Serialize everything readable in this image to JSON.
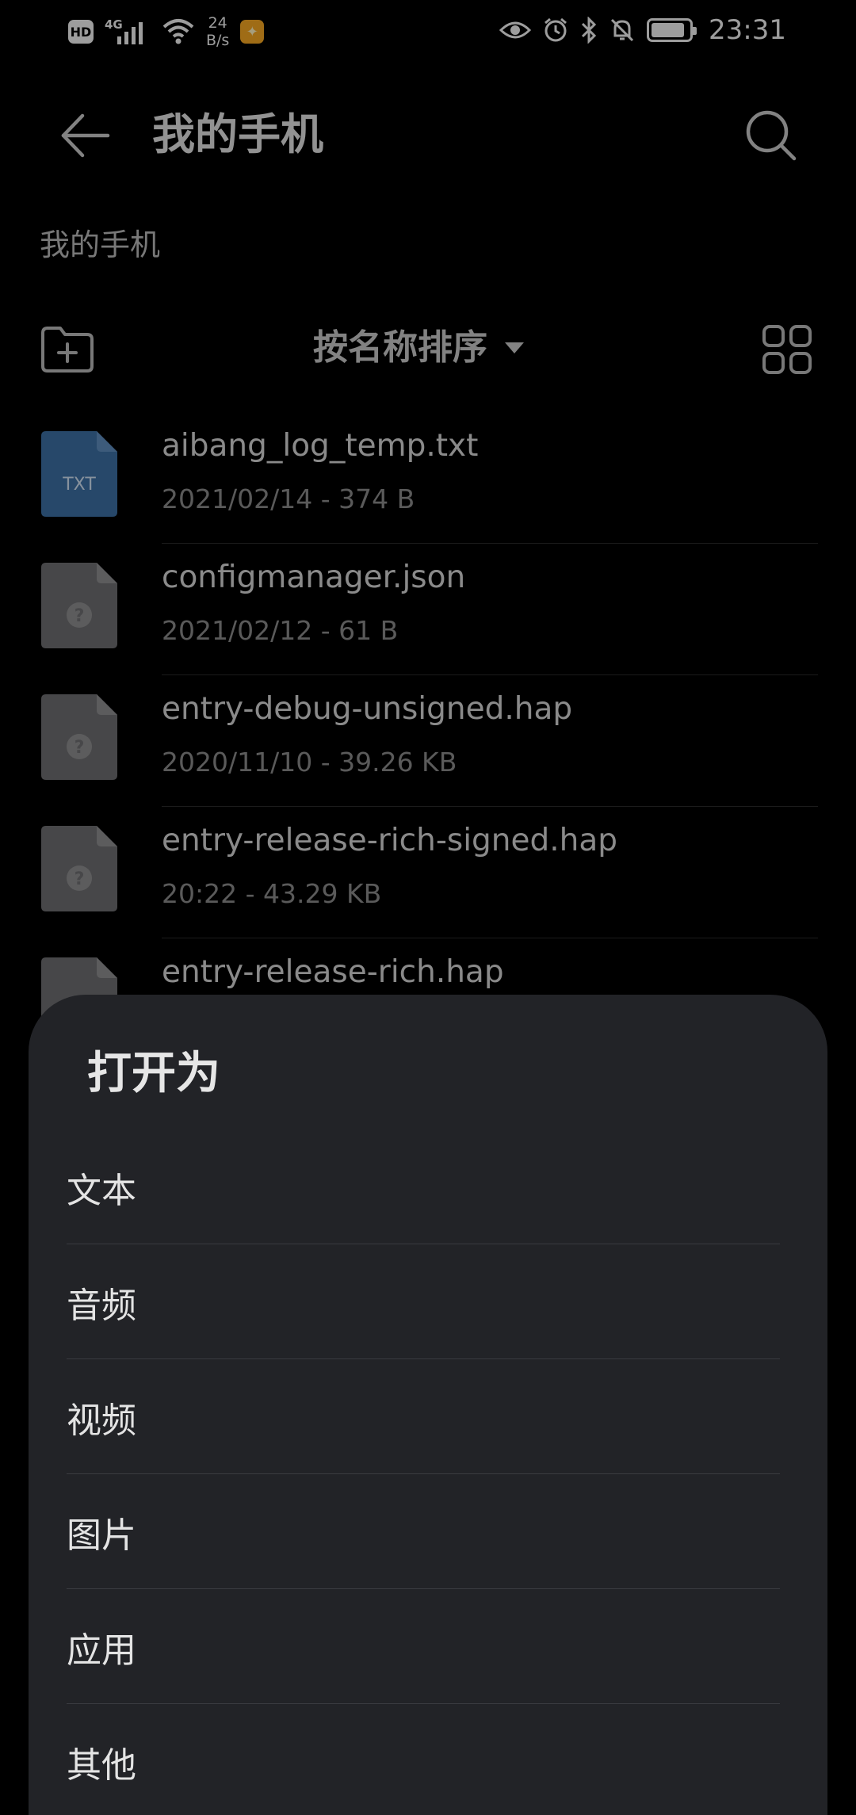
{
  "status_bar": {
    "hd": "HD",
    "network": "4G",
    "speed_value": "24",
    "speed_unit": "B/s",
    "time": "23:31",
    "battery_level": 0.9
  },
  "app_bar": {
    "title": "我的手机"
  },
  "breadcrumb": "我的手机",
  "toolbar": {
    "sort_label": "按名称排序"
  },
  "files": [
    {
      "name": "aibang_log_temp.txt",
      "meta": "2021/02/14 - 374 B",
      "icon": "txt-file-icon",
      "icon_label": "TXT"
    },
    {
      "name": "configmanager.json",
      "meta": "2021/02/12 - 61 B",
      "icon": "unknown-file-icon"
    },
    {
      "name": "entry-debug-unsigned.hap",
      "meta": "2020/11/10 - 39.26 KB",
      "icon": "unknown-file-icon"
    },
    {
      "name": "entry-release-rich-signed.hap",
      "meta": "20:22 - 43.29 KB",
      "icon": "unknown-file-icon"
    },
    {
      "name": "entry-release-rich.hap",
      "meta": "",
      "icon": "unknown-file-icon"
    }
  ],
  "open_as_sheet": {
    "title": "打开为",
    "options": [
      "文本",
      "音频",
      "视频",
      "图片",
      "应用",
      "其他"
    ]
  },
  "colors": {
    "background": "#000000",
    "sheet_background": "#222327",
    "txt_icon": "#3d6fa3",
    "unknown_icon": "#6e6e70"
  }
}
